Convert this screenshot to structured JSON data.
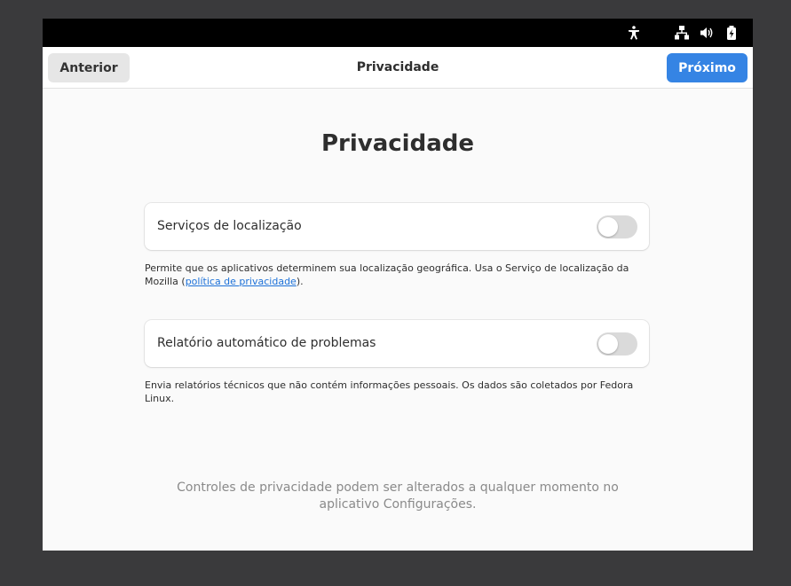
{
  "window": {
    "header_title": "Privacidade",
    "back_label": "Anterior",
    "next_label": "Próximo"
  },
  "topbar": {
    "icons": [
      "accessibility-icon",
      "network-wired-icon",
      "volume-icon",
      "battery-icon"
    ]
  },
  "page": {
    "title": "Privacidade",
    "settings": [
      {
        "label": "Serviços de localização",
        "enabled": false,
        "description_text": "Permite que os aplicativos determinem sua localização geográfica. Usa o Serviço de localização da Mozilla (",
        "description_link": "política de privacidade",
        "description_end": ")."
      },
      {
        "label": "Relatório automático de problemas",
        "enabled": false,
        "description_text": "Envia relatórios técnicos que não contém informações pessoais. Os dados são coletados por Fedora Linux."
      }
    ],
    "footer_note": "Controles de privacidade podem ser alterados a qualquer momento no aplicativo Configurações."
  },
  "colors": {
    "accent": "#3584e4",
    "link": "#1c71d8",
    "topbar": "#000000",
    "background": "#fafafa"
  }
}
